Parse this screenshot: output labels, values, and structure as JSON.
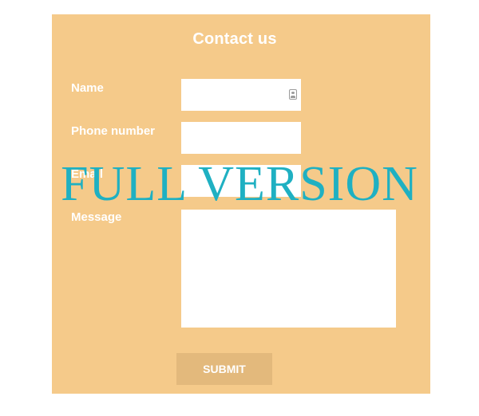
{
  "form": {
    "title": "Contact us",
    "fields": {
      "name": {
        "label": "Name",
        "value": "",
        "icon": "contact-card-icon"
      },
      "phone": {
        "label": "Phone number",
        "value": ""
      },
      "email": {
        "label": "Email",
        "value": ""
      },
      "message": {
        "label": "Message",
        "value": ""
      }
    },
    "submit_label": "SUBMIT"
  },
  "watermark": {
    "text": "FULL VERSION"
  },
  "colors": {
    "card_background": "#f5ca8a",
    "button_background": "#e3b97c",
    "watermark": "#1fb0c2",
    "text": "#ffffff"
  }
}
